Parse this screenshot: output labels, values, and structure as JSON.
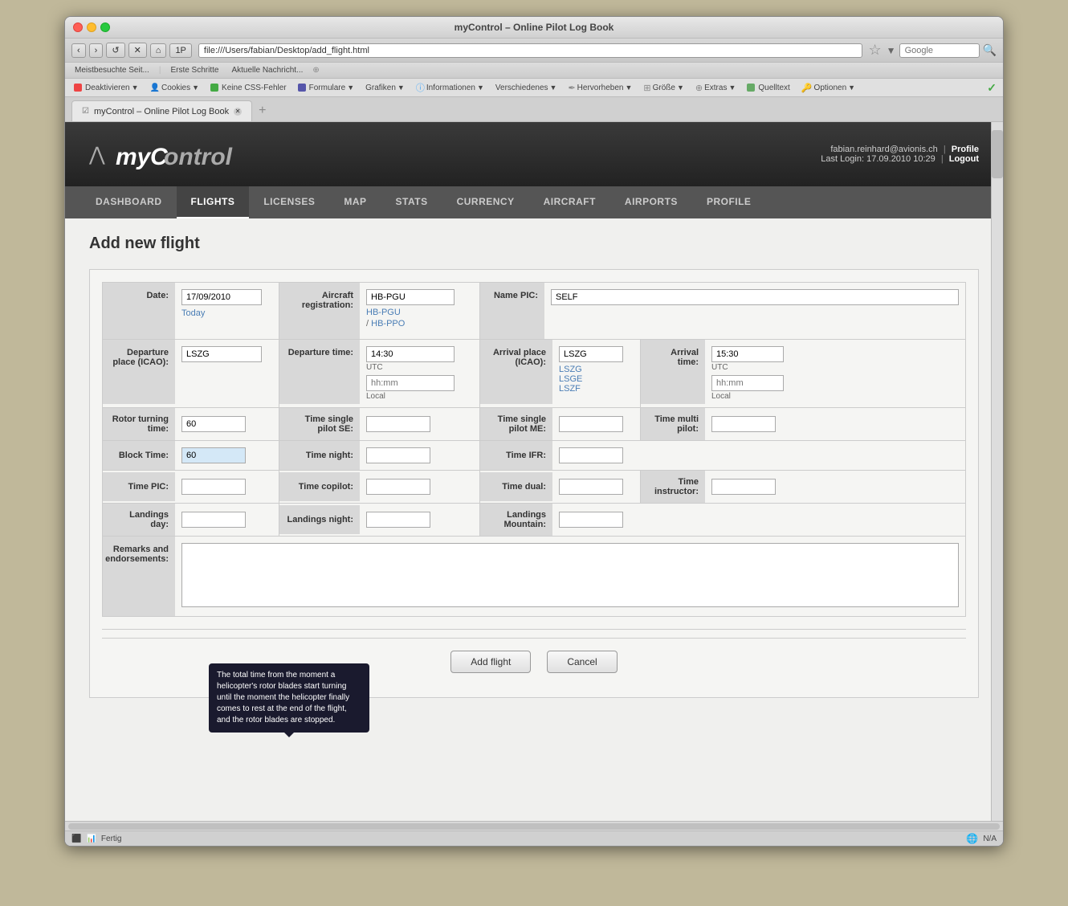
{
  "browser": {
    "title": "myControl – Online Pilot Log Book",
    "address": "file:///Users/fabian/Desktop/add_flight.html",
    "tab_label": "myControl – Online Pilot Log Book",
    "back_btn": "‹",
    "forward_btn": "›",
    "reload_btn": "↺",
    "stop_btn": "✕",
    "home_btn": "⌂",
    "plugin_btn": "1P",
    "search_placeholder": "Google"
  },
  "bookmarks": {
    "items": [
      "Meistbesuchte Seit...",
      "Erste Schritte",
      "Aktuelle Nachricht..."
    ]
  },
  "devtoolbar": {
    "items": [
      "Deaktivieren",
      "Cookies",
      "Keine CSS-Fehler",
      "Formulare",
      "Grafiken",
      "Informationen",
      "Verschiedenes",
      "Hervorheben",
      "Größe",
      "Extras",
      "Quelltext",
      "Optionen"
    ]
  },
  "user": {
    "email": "fabian.reinhard@avionis.ch",
    "profile_label": "Profile",
    "logout_label": "Logout",
    "last_login_label": "Last Login:",
    "last_login_value": "17.09.2010 10:29"
  },
  "nav": {
    "items": [
      {
        "label": "DASHBOARD",
        "active": false
      },
      {
        "label": "FLIGHTS",
        "active": true
      },
      {
        "label": "LICENSES",
        "active": false
      },
      {
        "label": "MAP",
        "active": false
      },
      {
        "label": "STATS",
        "active": false
      },
      {
        "label": "CURRENCY",
        "active": false
      },
      {
        "label": "AIRCRAFT",
        "active": false
      },
      {
        "label": "AIRPORTS",
        "active": false
      },
      {
        "label": "PROFILE",
        "active": false
      }
    ]
  },
  "page": {
    "title": "Add new flight"
  },
  "form": {
    "date_label": "Date:",
    "date_value": "17/09/2010",
    "today_label": "Today",
    "aircraft_reg_label": "Aircraft registration:",
    "aircraft_reg_value": "HB-PGU",
    "aircraft_suggestion1": "HB-PGU",
    "aircraft_suggestion2": "HB-PPO",
    "name_pic_label": "Name PIC:",
    "name_pic_value": "SELF",
    "departure_place_label": "Departure place (ICAO):",
    "departure_place_value": "LSZG",
    "departure_time_label": "Departure time:",
    "departure_time_utc": "14:30",
    "departure_utc_label": "UTC",
    "departure_time_local": "hh:mm",
    "departure_local_label": "Local",
    "arrival_place_label": "Arrival place (ICAO):",
    "arrival_place_value": "LSZG",
    "arrival_place_suggestion1": "LSZG",
    "arrival_place_suggestion2": "LSGE",
    "arrival_place_suggestion3": "LSZF",
    "arrival_time_label": "Arrival time:",
    "arrival_time_utc": "15:30",
    "arrival_utc_label": "UTC",
    "arrival_time_local": "hh:mm",
    "arrival_local_label": "Local",
    "rotor_turning_label": "Rotor turning time:",
    "rotor_turning_value": "60",
    "time_single_pilot_se_label": "Time single pilot SE:",
    "time_single_pilot_se_value": "",
    "time_single_pilot_me_label": "Time single pilot ME:",
    "time_single_pilot_me_value": "",
    "time_multi_pilot_label": "Time multi pilot:",
    "time_multi_pilot_value": "",
    "block_time_label": "Block Time:",
    "block_time_value": "60",
    "time_night_label": "Time night:",
    "time_night_value": "",
    "time_ifr_label": "Time IFR:",
    "time_ifr_value": "",
    "time_pic_label": "Time PIC:",
    "time_pic_value": "",
    "time_copilot_label": "Time copilot:",
    "time_copilot_value": "",
    "time_dual_label": "Time dual:",
    "time_dual_value": "",
    "time_instructor_label": "Time instructor:",
    "time_instructor_value": "",
    "landings_day_label": "Landings day:",
    "landings_day_value": "",
    "landings_night_label": "Landings night:",
    "landings_night_value": "",
    "landings_mountain_label": "Landings Mountain:",
    "landings_mountain_value": "",
    "remarks_label": "Remarks and endorsements:",
    "remarks_value": "",
    "add_flight_btn": "Add flight",
    "cancel_btn": "Cancel"
  },
  "tooltip": {
    "text": "The total time from the moment a helicopter's rotor blades start turning until the moment the helicopter finally comes to rest at the end of the flight, and the rotor blades are stopped."
  },
  "status_bar": {
    "status": "Fertig",
    "info": "N/A"
  }
}
